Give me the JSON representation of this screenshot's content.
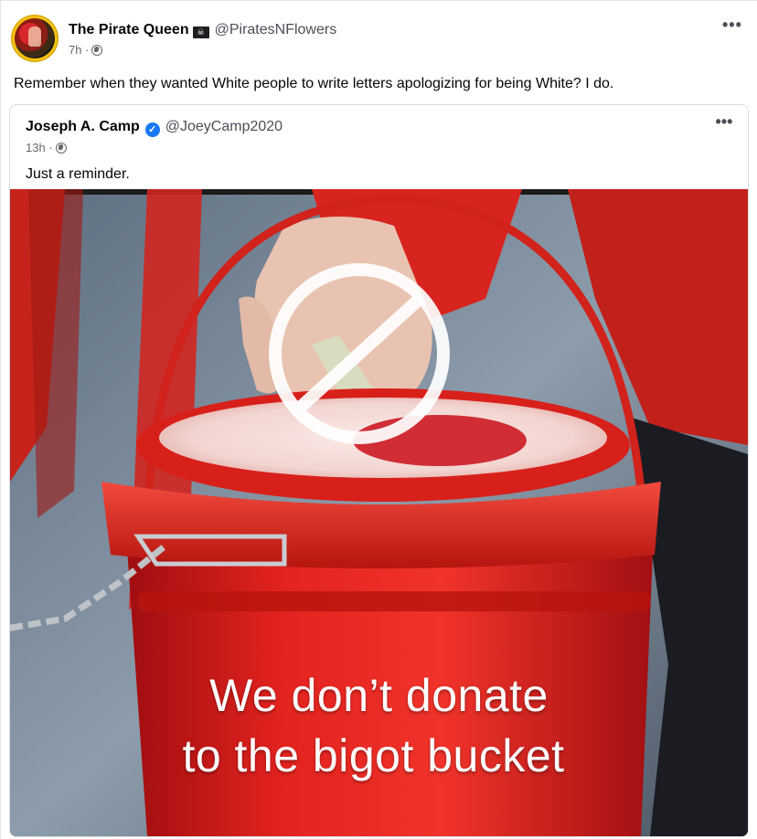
{
  "post": {
    "author_name": "The Pirate Queen",
    "author_flag_icon": "pirate-flag-icon",
    "author_handle": "@PiratesNFlowers",
    "timestamp": "7h",
    "separator": "·",
    "privacy_icon": "globe-icon",
    "more_label": "•••",
    "text": "Remember when they wanted White people to write letters apologizing for being White? I do."
  },
  "quoted_post": {
    "author_name": "Joseph A. Camp",
    "verified_icon": "verified-badge-icon",
    "verified_glyph": "✓",
    "author_handle": "@JoeyCamp2020",
    "timestamp": "13h",
    "separator": "·",
    "privacy_icon": "globe-icon",
    "more_label": "•••",
    "text": "Just a reminder.",
    "image": {
      "subject": "red donation bucket with prohibition sign",
      "caption_line_1": "We don’t donate",
      "caption_line_2": "to the bigot bucket"
    }
  },
  "colors": {
    "accent_blue": "#1877f2",
    "text_primary": "#050505",
    "text_secondary": "#65676b",
    "bucket_red": "#e0201d"
  }
}
